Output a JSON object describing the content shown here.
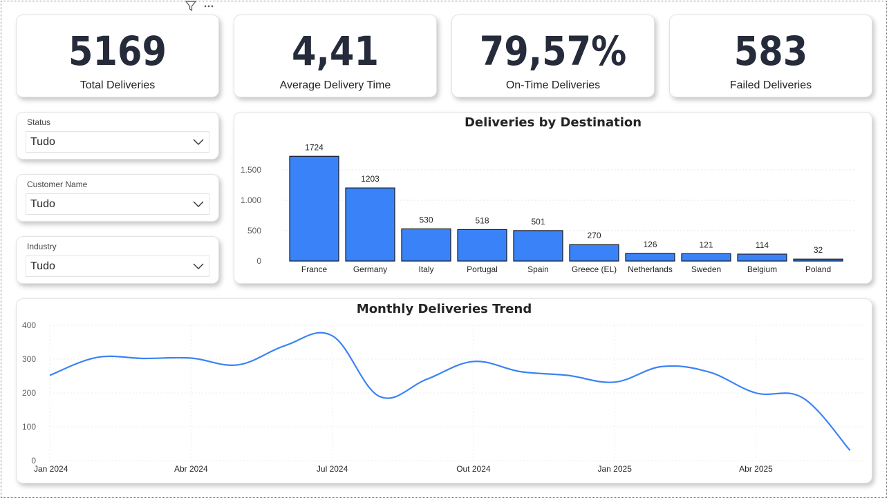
{
  "kpis": [
    {
      "value": "5169",
      "label": "Total Deliveries"
    },
    {
      "value": "4,41",
      "label": "Average Delivery Time"
    },
    {
      "value": "79,57%",
      "label": "On-Time Deliveries"
    },
    {
      "value": "583",
      "label": "Failed Deliveries"
    }
  ],
  "slicers": [
    {
      "title": "Status",
      "value": "Tudo"
    },
    {
      "title": "Customer Name",
      "value": "Tudo"
    },
    {
      "title": "Industry",
      "value": "Tudo"
    }
  ],
  "header_icons": [
    "filter-icon",
    "more-options-icon"
  ],
  "colors": {
    "bar": "#3a82f7",
    "line": "#3a82f7",
    "kpi_text": "#252b3a"
  },
  "bar_chart": {
    "title": "Deliveries by Destination",
    "chart_data": {
      "type": "bar",
      "categories": [
        "France",
        "Germany",
        "Italy",
        "Portugal",
        "Spain",
        "Greece (EL)",
        "Netherlands",
        "Sweden",
        "Belgium",
        "Poland"
      ],
      "values": [
        1724,
        1203,
        530,
        518,
        501,
        270,
        126,
        121,
        114,
        32
      ],
      "data_labels": [
        "1724",
        "1203",
        "530",
        "518",
        "501",
        "270",
        "126",
        "121",
        "114",
        "32"
      ],
      "y_ticks": [
        "0",
        "500",
        "1.000",
        "1.500"
      ],
      "y_tick_values": [
        0,
        500,
        1000,
        1500
      ],
      "ylim": [
        0,
        1900
      ],
      "grid": true
    }
  },
  "line_chart": {
    "title": "Monthly Deliveries Trend",
    "chart_data": {
      "type": "line",
      "x": [
        "2024-01",
        "2024-02",
        "2024-03",
        "2024-04",
        "2024-05",
        "2024-06",
        "2024-07",
        "2024-08",
        "2024-09",
        "2024-10",
        "2024-11",
        "2024-12",
        "2025-01",
        "2025-02",
        "2025-03",
        "2025-04",
        "2025-05",
        "2025-06"
      ],
      "values": [
        252,
        305,
        302,
        303,
        283,
        340,
        369,
        190,
        240,
        293,
        263,
        252,
        232,
        278,
        262,
        200,
        185,
        30
      ],
      "x_ticks": [
        "Jan 2024",
        "Abr 2024",
        "Jul 2024",
        "Out 2024",
        "Jan 2025",
        "Abr 2025"
      ],
      "x_tick_index": [
        0,
        3,
        6,
        9,
        12,
        15
      ],
      "y_ticks": [
        "0",
        "100",
        "200",
        "300",
        "400"
      ],
      "y_tick_values": [
        0,
        100,
        200,
        300,
        400
      ],
      "ylim": [
        0,
        400
      ],
      "grid": true
    }
  }
}
